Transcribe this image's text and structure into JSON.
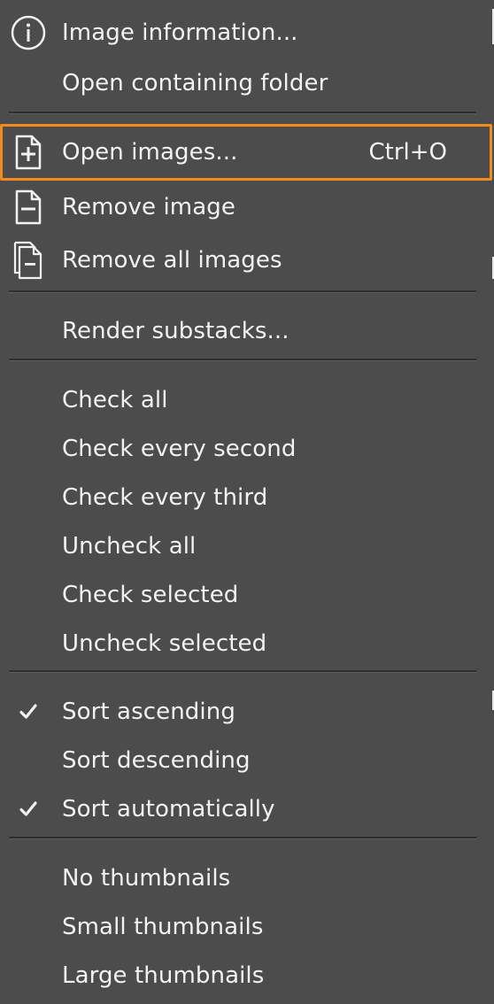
{
  "menu": {
    "items": [
      {
        "label": "Image information...",
        "icon": "info-icon"
      },
      {
        "label": "Open containing folder"
      },
      {
        "label": "Open images...",
        "shortcut": "Ctrl+O",
        "icon": "file-add-icon",
        "highlighted": true
      },
      {
        "label": "Remove image",
        "icon": "file-remove-icon"
      },
      {
        "label": "Remove all images",
        "icon": "files-remove-icon"
      },
      {
        "label": "Render substacks..."
      },
      {
        "label": "Check all"
      },
      {
        "label": "Check every second"
      },
      {
        "label": "Check every third"
      },
      {
        "label": "Uncheck all"
      },
      {
        "label": "Check selected"
      },
      {
        "label": "Uncheck selected"
      },
      {
        "label": "Sort ascending",
        "checked": true
      },
      {
        "label": "Sort descending",
        "checked": false
      },
      {
        "label": "Sort automatically",
        "checked": true
      },
      {
        "label": "No thumbnails"
      },
      {
        "label": "Small thumbnails"
      },
      {
        "label": "Large thumbnails"
      }
    ]
  },
  "colors": {
    "background": "#4c4c4c",
    "text": "#f2f2f2",
    "highlight_border": "#f58a1f",
    "separator": "#2e2e2e"
  }
}
